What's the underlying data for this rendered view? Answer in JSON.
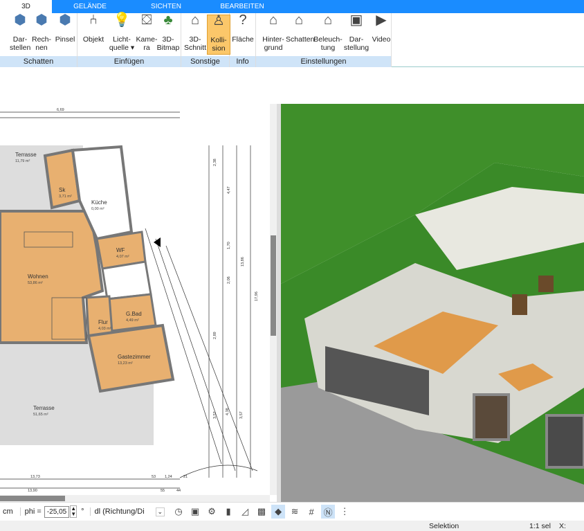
{
  "tabs": [
    {
      "label": "3D",
      "active": true
    },
    {
      "label": "GELÄNDE"
    },
    {
      "label": "SICHTEN"
    },
    {
      "label": "BEARBEITEN"
    }
  ],
  "ribbon": {
    "groups": [
      {
        "label": "Schatten",
        "buttons": [
          {
            "l1": "Dar-",
            "l2": "stellen",
            "icon": "cube-display-icon"
          },
          {
            "l1": "Rech-",
            "l2": "nen",
            "icon": "cube-compute-icon"
          },
          {
            "l1": "Pinsel",
            "l2": "",
            "icon": "cube-brush-icon"
          }
        ]
      },
      {
        "label": "Einfügen",
        "buttons": [
          {
            "l1": "Objekt",
            "l2": "",
            "icon": "chair-icon"
          },
          {
            "l1": "Licht-",
            "l2": "quelle ▾",
            "icon": "lightbulb-icon"
          },
          {
            "l1": "Kame-",
            "l2": "ra",
            "icon": "camera-icon"
          },
          {
            "l1": "3D-",
            "l2": "Bitmap",
            "icon": "tree-icon"
          }
        ]
      },
      {
        "label": "Sonstige",
        "buttons": [
          {
            "l1": "3D-",
            "l2": "Schnitt",
            "icon": "section-icon"
          },
          {
            "l1": "Kolli-",
            "l2": "sion",
            "icon": "collision-icon",
            "active": true
          }
        ]
      },
      {
        "label": "Info",
        "buttons": [
          {
            "l1": "Fläche",
            "l2": "",
            "icon": "area-info-icon"
          }
        ]
      },
      {
        "label": "Einstellungen",
        "buttons": [
          {
            "l1": "Hinter-",
            "l2": "grund",
            "icon": "house-background-icon"
          },
          {
            "l1": "Schatten",
            "l2": "",
            "icon": "house-shadow-icon"
          },
          {
            "l1": "Beleuch-",
            "l2": "tung",
            "icon": "house-light-icon"
          },
          {
            "l1": "Dar-",
            "l2": "stellung",
            "icon": "monitor-gear-icon"
          },
          {
            "l1": "Video",
            "l2": "",
            "icon": "play-icon"
          }
        ]
      }
    ]
  },
  "plan": {
    "rooms": [
      {
        "name": "Terrasse",
        "area": "11,79 m²"
      },
      {
        "name": "Sk",
        "area": "3,71 m²"
      },
      {
        "name": "Küche",
        "area": "0,00 m²"
      },
      {
        "name": "WF",
        "area": "4,07 m²"
      },
      {
        "name": "Wohnen",
        "area": "53,86 m²"
      },
      {
        "name": "G.Bad",
        "area": "4,49 m²"
      },
      {
        "name": "Flur",
        "area": "4,03 m²"
      },
      {
        "name": "Gastezimmer",
        "area": "13,23 m²"
      },
      {
        "name": "Terrasse",
        "area": "51,65 m²"
      }
    ],
    "dims": {
      "top": "6,69",
      "r1": "2,38",
      "r2": "4,47",
      "r3": "13,86",
      "r4": "17,96",
      "r5": "3,57",
      "r6": "4,38",
      "r7": "3,57",
      "r8": "2,89",
      "r9": "1,70",
      "r10": "2,06",
      "b1": "13,73",
      "b2": "13,90",
      "b3": "53",
      "b4": "1,24",
      "b5": "21",
      "b6": "55",
      "b7": "44"
    }
  },
  "toolbar": {
    "unit": "cm",
    "phi_label": "phi =",
    "phi_value": "-25,05",
    "degree": "°",
    "mode_value": "dl (Richtung/Di"
  },
  "status": {
    "mode": "Selektion",
    "scale": "1:1 sel",
    "coord": "X:"
  },
  "colors": {
    "accent": "#1a8cff",
    "active_button": "#fbc76a",
    "floor_wood": "#e8b070",
    "grass": "#3f8f2a"
  }
}
